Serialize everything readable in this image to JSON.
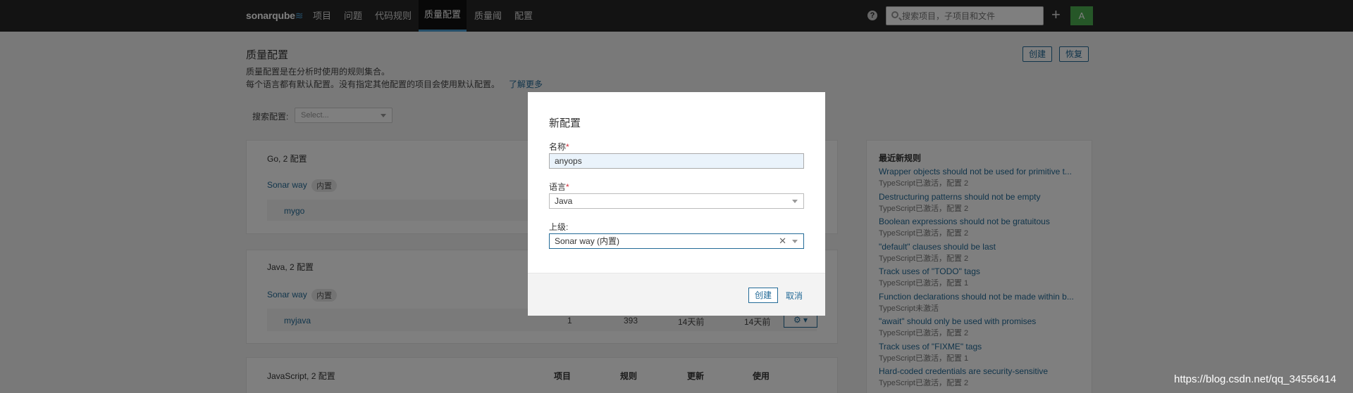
{
  "nav": {
    "logo": "sonarqube",
    "items": [
      "项目",
      "问题",
      "代码规则",
      "质量配置",
      "质量阈",
      "配置"
    ],
    "active_index": 3,
    "search_placeholder": "搜索项目，子项目和文件",
    "avatar": "A",
    "help": "?",
    "plus": "+"
  },
  "page": {
    "title": "质量配置",
    "desc_line1": "质量配置是在分析时使用的规则集合。",
    "desc_line2": "每个语言都有默认配置。没有指定其他配置的项目会使用默认配置。",
    "learn_more": "了解更多",
    "create_button": "创建",
    "restore_button": "恢复",
    "search_label": "搜索配置:",
    "search_placeholder": "Select..."
  },
  "cards": [
    {
      "title": "Go, 2 配置",
      "builtin_name": "Sonar way",
      "builtin_badge": "内置",
      "child": "mygo"
    },
    {
      "title": "Java, 2 配置",
      "builtin_name": "Sonar way",
      "builtin_badge": "内置",
      "child": "myjava",
      "child_projects": "1",
      "child_rules": "393",
      "child_updated": "14天前",
      "child_used": "14天前"
    },
    {
      "title": "JavaScript, 2 配置",
      "headers": [
        "项目",
        "规则",
        "更新",
        "使用"
      ]
    }
  ],
  "sidebar": {
    "title": "最近新规则",
    "rules": [
      {
        "name": "Wrapper objects should not be used for primitive t...",
        "meta": "TypeScript已激活，配置 2"
      },
      {
        "name": "Destructuring patterns should not be empty",
        "meta": "TypeScript已激活，配置 2"
      },
      {
        "name": "Boolean expressions should not be gratuitous",
        "meta": "TypeScript已激活，配置 2"
      },
      {
        "name": "\"default\" clauses should be last",
        "meta": "TypeScript已激活，配置 2"
      },
      {
        "name": "Track uses of \"TODO\" tags",
        "meta": "TypeScript已激活，配置 1"
      },
      {
        "name": "Function declarations should not be made within b...",
        "meta": "TypeScript未激活"
      },
      {
        "name": "\"await\" should only be used with promises",
        "meta": "TypeScript已激活，配置 2"
      },
      {
        "name": "Track uses of \"FIXME\" tags",
        "meta": "TypeScript已激活，配置 1"
      },
      {
        "name": "Hard-coded credentials are security-sensitive",
        "meta": "TypeScript已激活，配置 2"
      }
    ]
  },
  "modal": {
    "title": "新配置",
    "name_label": "名称",
    "name_value": "anyops",
    "language_label": "语言",
    "language_value": "Java",
    "parent_label": "上级:",
    "parent_value": "Sonar way (内置)",
    "required_mark": "*",
    "create_button": "创建",
    "cancel_button": "取消"
  },
  "watermark": "https://blog.csdn.net/qq_34556414"
}
